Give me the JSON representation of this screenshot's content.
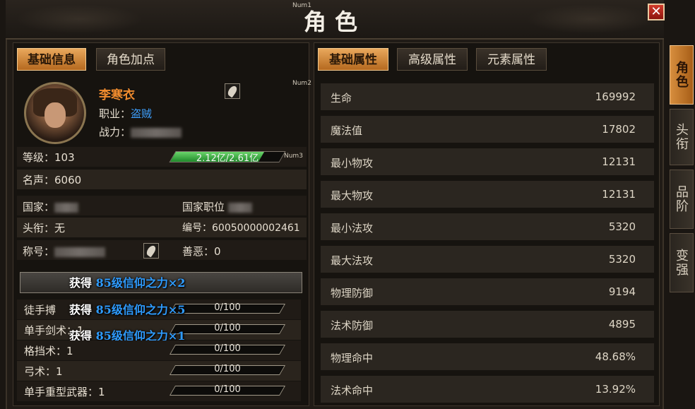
{
  "window": {
    "title": "角色",
    "num_labels": [
      "Num1",
      "Num2",
      "Num3"
    ],
    "close_glyph": "✕"
  },
  "left_tabs": [
    {
      "label": "基础信息",
      "active": true
    },
    {
      "label": "角色加点",
      "active": false
    }
  ],
  "right_tabs": [
    {
      "label": "基础属性",
      "active": true
    },
    {
      "label": "高级属性",
      "active": false
    },
    {
      "label": "元素属性",
      "active": false
    }
  ],
  "profile": {
    "name": "李寒衣",
    "job_label": "职业：",
    "job_value": "盗贼",
    "power_label": "战力：",
    "level": "等级：103",
    "exp_text": "2.12亿/2.61亿",
    "exp_fraction": 0.81,
    "fame": "名声：6060",
    "country_label": "国家：",
    "country_post_label": "国家职位",
    "rank_title": "头衔：无",
    "serial": "编号：60050000002461",
    "alias_label": "称号：",
    "karma": "善恶：0"
  },
  "skills": {
    "header_text": "获得 85级信仰之力×2",
    "rows": [
      {
        "name": "徒手搏",
        "value": "0/100",
        "overlay": "获得 85级信仰之力×5"
      },
      {
        "name": "单手剑术：1",
        "value": "0/100",
        "overlay": "获得 85级信仰之力×1"
      },
      {
        "name": "格挡术：1",
        "value": "0/100"
      },
      {
        "name": "弓术：1",
        "value": "0/100"
      },
      {
        "name": "单手重型武器：1",
        "value": "0/100"
      }
    ]
  },
  "stats": [
    {
      "name": "生命",
      "value": "169992"
    },
    {
      "name": "魔法值",
      "value": "17802"
    },
    {
      "name": "最小物攻",
      "value": "12131"
    },
    {
      "name": "最大物攻",
      "value": "12131"
    },
    {
      "name": "最小法攻",
      "value": "5320"
    },
    {
      "name": "最大法攻",
      "value": "5320"
    },
    {
      "name": "物理防御",
      "value": "9194"
    },
    {
      "name": "法术防御",
      "value": "4895"
    },
    {
      "name": "物理命中",
      "value": "48.68%"
    },
    {
      "name": "法术命中",
      "value": "13.92%"
    }
  ],
  "side_tabs": [
    {
      "label": "角色",
      "active": true
    },
    {
      "label": "头衔",
      "active": false
    },
    {
      "label": "品阶",
      "active": false
    },
    {
      "label": "变强",
      "active": false
    }
  ],
  "colors": {
    "accent": "#e9a85c",
    "name": "#f08b2e",
    "link": "#3ea0ff",
    "exp": "#2e9b34"
  }
}
